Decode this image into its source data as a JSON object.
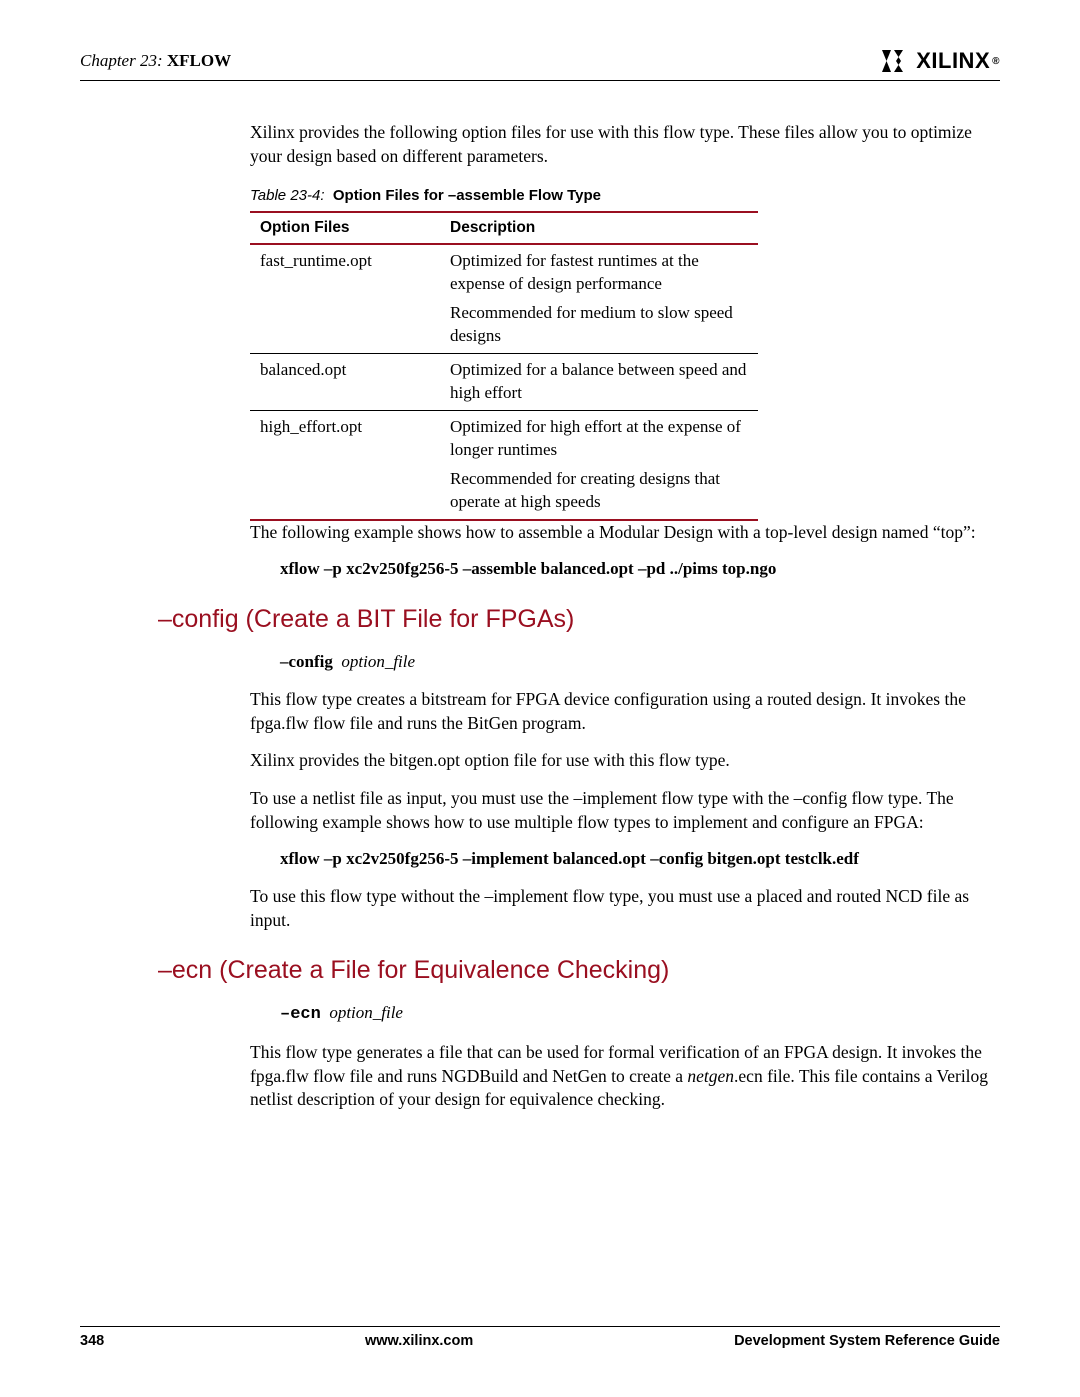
{
  "header": {
    "chapter_prefix": "Chapter 23:",
    "chapter_title": "XFLOW",
    "brand": "XILINX"
  },
  "intro_para": "Xilinx provides the following option files for use with this flow type. These files allow you to optimize your design based on different parameters.",
  "table": {
    "caption_pre": "Table 23-4:",
    "caption_post": "Option Files for –assemble Flow Type",
    "headers": {
      "c1": "Option Files",
      "c2": "Description"
    },
    "rows": [
      {
        "file": "fast_runtime.opt",
        "desc": [
          "Optimized for fastest runtimes at the expense of design performance",
          "Recommended for medium to slow speed designs"
        ]
      },
      {
        "file": "balanced.opt",
        "desc": [
          "Optimized for a balance between speed and high effort"
        ]
      },
      {
        "file": "high_effort.opt",
        "desc": [
          "Optimized for high effort at the expense of longer runtimes",
          "Recommended for creating designs that operate at high speeds"
        ]
      }
    ]
  },
  "after_table_para": "The following example shows how to assemble a Modular Design with a top-level design named “top”:",
  "cmd1": "xflow –p xc2v250fg256-5 –assemble balanced.opt  –pd ../pims  top.ngo",
  "section_config": {
    "title": "–config (Create a BIT File for FPGAs)",
    "syntax_kw": "–config",
    "syntax_arg": "option_file",
    "p1": "This flow type creates a bitstream for FPGA device configuration using a routed design. It invokes the fpga.flw flow file and runs the BitGen program.",
    "p2": "Xilinx provides the bitgen.opt option file for use with this flow type.",
    "p3": "To use a netlist file as input, you must use the –implement flow type with the –config flow type. The following example shows how to use multiple flow types to implement and configure an FPGA:",
    "cmd": "xflow –p xc2v250fg256-5 –implement balanced.opt  –config bitgen.opt  testclk.edf",
    "p4": "To use this flow type without the –implement flow type, you must use a placed and routed NCD file as input."
  },
  "section_ecn": {
    "title": "–ecn (Create a File for Equivalence Checking)",
    "syntax_kw": "–ecn",
    "syntax_arg": "option_file",
    "p1_a": "This flow type generates a file that can be used for formal verification of an FPGA design. It invokes the fpga.flw flow file and runs NGDBuild and NetGen to create a ",
    "p1_em": "netgen",
    "p1_b": ".ecn file. This file contains a Verilog netlist description of your design for equivalence checking."
  },
  "footer": {
    "page": "348",
    "url": "www.xilinx.com",
    "doc": "Development System Reference Guide"
  }
}
